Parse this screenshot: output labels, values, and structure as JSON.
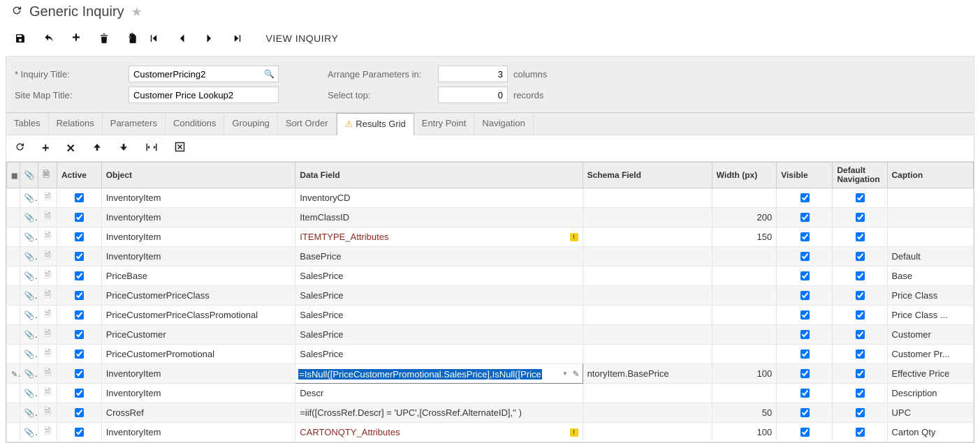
{
  "header": {
    "title": "Generic Inquiry",
    "view_inquiry": "VIEW INQUIRY"
  },
  "form": {
    "inquiry_title_label": "* Inquiry Title:",
    "inquiry_title": "CustomerPricing2",
    "site_map_title_label": "Site Map Title:",
    "site_map_title": "Customer Price Lookup2",
    "arrange_label": "Arrange Parameters in:",
    "arrange_value": "3",
    "arrange_unit": "columns",
    "select_top_label": "Select top:",
    "select_top_value": "0",
    "select_top_unit": "records"
  },
  "tabs": [
    {
      "label": "Tables",
      "active": false
    },
    {
      "label": "Relations",
      "active": false
    },
    {
      "label": "Parameters",
      "active": false
    },
    {
      "label": "Conditions",
      "active": false
    },
    {
      "label": "Grouping",
      "active": false
    },
    {
      "label": "Sort Order",
      "active": false
    },
    {
      "label": "Results Grid",
      "active": true,
      "warn": true
    },
    {
      "label": "Entry Point",
      "active": false
    },
    {
      "label": "Navigation",
      "active": false
    }
  ],
  "grid": {
    "columns": {
      "active": "Active",
      "object": "Object",
      "data_field": "Data Field",
      "schema_field": "Schema Field",
      "width": "Width (px)",
      "visible": "Visible",
      "default_nav": "Default Navigation",
      "caption": "Caption"
    },
    "rows": [
      {
        "active": true,
        "object": "InventoryItem",
        "data_field": "InventoryCD",
        "schema_field": "",
        "width": "",
        "visible": true,
        "default_nav": true,
        "caption": ""
      },
      {
        "active": true,
        "object": "InventoryItem",
        "data_field": "ItemClassID",
        "schema_field": "",
        "width": "200",
        "visible": true,
        "default_nav": true,
        "caption": ""
      },
      {
        "active": true,
        "object": "InventoryItem",
        "data_field": "ITEMTYPE_Attributes",
        "data_field_style": "attr",
        "warn": true,
        "schema_field": "",
        "width": "150",
        "visible": true,
        "default_nav": true,
        "caption": ""
      },
      {
        "active": true,
        "object": "InventoryItem",
        "data_field": "BasePrice",
        "schema_field": "",
        "width": "",
        "visible": true,
        "default_nav": true,
        "caption": "Default"
      },
      {
        "active": true,
        "object": "PriceBase",
        "data_field": "SalesPrice",
        "schema_field": "",
        "width": "",
        "visible": true,
        "default_nav": true,
        "caption": "Base"
      },
      {
        "active": true,
        "object": "PriceCustomerPriceClass",
        "data_field": "SalesPrice",
        "schema_field": "",
        "width": "",
        "visible": true,
        "default_nav": true,
        "caption": "Price Class"
      },
      {
        "active": true,
        "object": "PriceCustomerPriceClassPromotional",
        "data_field": "SalesPrice",
        "schema_field": "",
        "width": "",
        "visible": true,
        "default_nav": true,
        "caption": "Price Class ..."
      },
      {
        "active": true,
        "object": "PriceCustomer",
        "data_field": "SalesPrice",
        "schema_field": "",
        "width": "",
        "visible": true,
        "default_nav": true,
        "caption": "Customer"
      },
      {
        "active": true,
        "object": "PriceCustomerPromotional",
        "data_field": "SalesPrice",
        "schema_field": "",
        "width": "",
        "visible": true,
        "default_nav": true,
        "caption": "Customer Pr..."
      },
      {
        "editing": true,
        "active": true,
        "object": "InventoryItem",
        "data_field": "=IsNull([PriceCustomerPromotional.SalesPrice],IsNull([Price",
        "schema_field": "ntoryItem.BasePrice",
        "width": "100",
        "visible": true,
        "default_nav": true,
        "caption": "Effective Price"
      },
      {
        "active": true,
        "object": "InventoryItem",
        "data_field": "Descr",
        "schema_field": "",
        "width": "",
        "visible": true,
        "default_nav": true,
        "caption": "Description"
      },
      {
        "active": true,
        "object": "CrossRef",
        "data_field": "=iif([CrossRef.Descr] = 'UPC',[CrossRef.AlternateID],'' )",
        "schema_field": "",
        "width": "50",
        "visible": true,
        "default_nav": true,
        "caption": "UPC"
      },
      {
        "active": true,
        "object": "InventoryItem",
        "data_field": "CARTONQTY_Attributes",
        "data_field_style": "attr",
        "warn": true,
        "schema_field": "",
        "width": "100",
        "visible": true,
        "default_nav": true,
        "caption": "Carton Qty"
      }
    ]
  }
}
